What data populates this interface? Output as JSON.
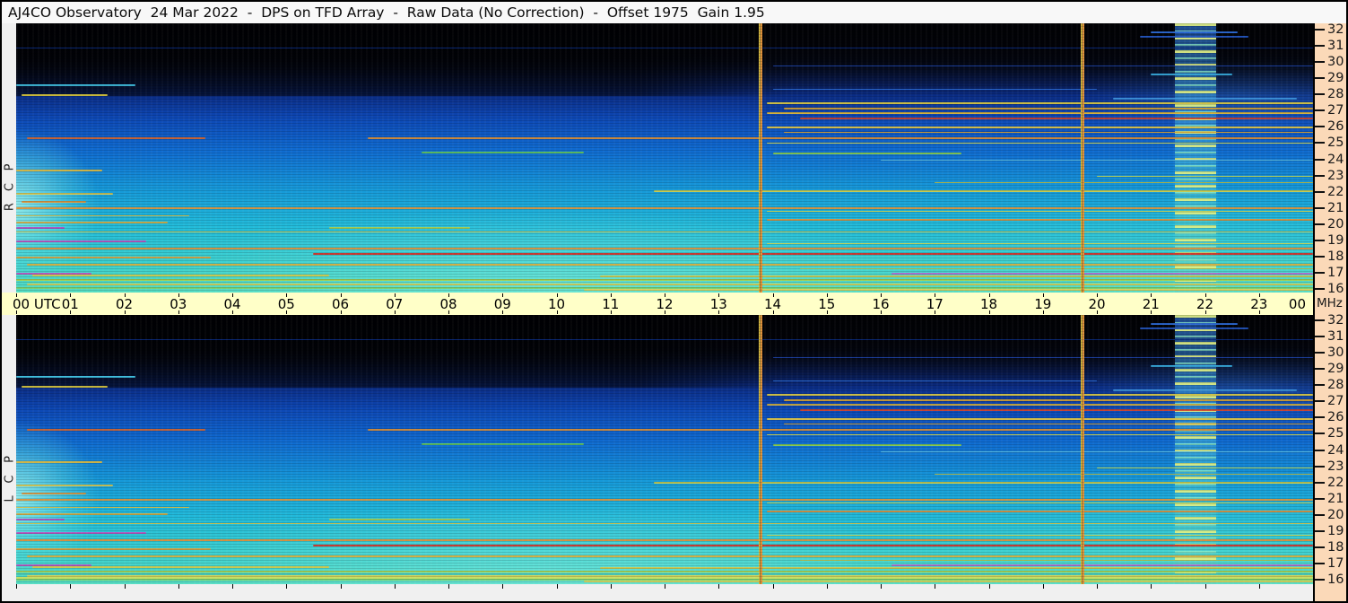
{
  "title": "AJ4CO Observatory  24 Mar 2022  -  DPS on TFD Array  -  Raw Data (No Correction)  -  Offset 1975  Gain 1.95",
  "colors": {
    "titlebar_bg": "#f8f8f8",
    "time_axis_bg": "#ffffc8",
    "freq_gutter_bg": "#fbd9b8",
    "margin_bg": "#f0f0f0",
    "frame_border": "#000000",
    "marker_yellow": "#e5c33c",
    "marker_orange": "#e0923c"
  },
  "chart_data": {
    "type": "heatmap",
    "title": "AJ4CO Observatory  24 Mar 2022  -  DPS on TFD Array  -  Raw Data (No Correction)  -  Offset 1975  Gain 1.95",
    "observatory": "AJ4CO Observatory",
    "date": "24 Mar 2022",
    "instrument": "DPS on TFD Array",
    "data_state": "Raw Data (No Correction)",
    "offset": 1975,
    "gain": 1.95,
    "x_axis": {
      "unit": "UTC",
      "range_hours": [
        0,
        24
      ],
      "tick_labels": [
        "00 UTC",
        "01",
        "02",
        "03",
        "04",
        "05",
        "06",
        "07",
        "08",
        "09",
        "10",
        "11",
        "12",
        "13",
        "14",
        "15",
        "16",
        "17",
        "18",
        "19",
        "20",
        "21",
        "22",
        "23",
        "00"
      ]
    },
    "y_axis": {
      "unit": "MHz",
      "range_mhz": [
        16,
        32
      ],
      "ticks": [
        32,
        31,
        30,
        29,
        28,
        27,
        26,
        25,
        24,
        23,
        22,
        21,
        20,
        19,
        18,
        17,
        16
      ]
    },
    "panels": [
      {
        "id": "rcp",
        "label": "RCP"
      },
      {
        "id": "lcp",
        "label": "LCP"
      }
    ],
    "legend_position": "none",
    "grid": false,
    "colorscale_low_to_high": [
      "#000000",
      "#081536",
      "#0a2a80",
      "#0f6ad0",
      "#169ad9",
      "#3bd0cf",
      "#55dcc2",
      "#a8cf4e",
      "#dcd052",
      "#e0913a",
      "#cc2d24"
    ],
    "vertical_markers_utc": [
      13.78,
      19.73
    ],
    "interference_band_utc": {
      "start": 21.45,
      "end": 22.2
    },
    "background_features": [
      "black above ~28 MHz fading to dark blue on the right half",
      "bright cyan blob at 00-01.5 UTC around 18-23 MHz",
      "broad bright cyan region ~07-13 UTC below 22 MHz",
      "dense yellow-orange RFI band 26.5-27.7 MHz after 14 UTC",
      "striped interference column 21.45-22.2 UTC full bandwidth"
    ],
    "rfi_lines": [
      [
        30.9,
        0,
        24,
        "#0a2f8c",
        1
      ],
      [
        29.8,
        14,
        10,
        "#1b3fa0",
        1
      ],
      [
        28.6,
        0,
        2.2,
        "#44ccee",
        2
      ],
      [
        28.35,
        14,
        6,
        "#2a6ad4",
        1
      ],
      [
        28.0,
        0.1,
        1.6,
        "#d4c23a",
        2
      ],
      [
        27.8,
        20.3,
        3.4,
        "#3e97e0",
        2
      ],
      [
        27.5,
        13.9,
        10.1,
        "#d9c53e",
        2
      ],
      [
        27.2,
        14.2,
        9.8,
        "#cf9a2e",
        2
      ],
      [
        26.9,
        13.9,
        10.1,
        "#e0b93a",
        2
      ],
      [
        26.6,
        14.5,
        9.5,
        "#d2452a",
        2
      ],
      [
        26.0,
        13.9,
        10.1,
        "#e0c340",
        2
      ],
      [
        25.7,
        14.2,
        9.8,
        "#d0992e",
        1
      ],
      [
        25.35,
        0.2,
        3.3,
        "#d0622a",
        2
      ],
      [
        25.35,
        6.5,
        17.5,
        "#d78a30",
        2
      ],
      [
        25.0,
        13.9,
        10.1,
        "#cfd04a",
        1
      ],
      [
        24.45,
        7.5,
        3,
        "#64c85a",
        2
      ],
      [
        24.4,
        14,
        3.5,
        "#8ccf4a",
        2
      ],
      [
        24.0,
        16,
        8,
        "#58b6d8",
        1
      ],
      [
        23.35,
        0,
        1.6,
        "#d9b43c",
        2
      ],
      [
        23.0,
        20,
        4,
        "#bcd24e",
        1
      ],
      [
        22.6,
        17,
        7,
        "#cfd04a",
        1
      ],
      [
        22.1,
        11.8,
        12.2,
        "#d4cf46",
        2
      ],
      [
        21.9,
        0,
        1.8,
        "#dcc84e",
        2
      ],
      [
        21.45,
        0.1,
        1.2,
        "#e0953a",
        2
      ],
      [
        21.05,
        0,
        24,
        "#de8f35",
        2
      ],
      [
        20.8,
        13.9,
        10.1,
        "#c9cf4e",
        1
      ],
      [
        20.55,
        0,
        3.2,
        "#d2b844",
        1
      ],
      [
        20.3,
        13.9,
        10.1,
        "#e0913a",
        2
      ],
      [
        20.15,
        0,
        2.8,
        "#d9ab40",
        2
      ],
      [
        19.8,
        0,
        0.9,
        "#b44fc0",
        2
      ],
      [
        19.8,
        5.8,
        2.6,
        "#aacf4e",
        2
      ],
      [
        19.55,
        0,
        24,
        "#cdbf48",
        1
      ],
      [
        19.0,
        0,
        2.4,
        "#c050c0",
        2
      ],
      [
        18.8,
        13.9,
        10.1,
        "#ccd04e",
        1
      ],
      [
        18.55,
        0,
        24,
        "#e08a32",
        2
      ],
      [
        18.2,
        5.5,
        18.5,
        "#cc2d24",
        2
      ],
      [
        18.0,
        0,
        3.6,
        "#e0a13c",
        2
      ],
      [
        17.55,
        0.2,
        23.8,
        "#d9ab38",
        2
      ],
      [
        17.3,
        14.5,
        9.5,
        "#c8cf52",
        1
      ],
      [
        17.0,
        0,
        1.4,
        "#c050c0",
        2
      ],
      [
        17.0,
        16.2,
        7.8,
        "#b46ad0",
        2
      ],
      [
        16.9,
        0.3,
        5.5,
        "#d2c544",
        2
      ],
      [
        16.85,
        10.8,
        13.2,
        "#d5c94a",
        2
      ],
      [
        16.6,
        0,
        24,
        "#a8cf4e",
        2
      ],
      [
        16.35,
        0.2,
        23.8,
        "#dcd052",
        2
      ],
      [
        16.1,
        0,
        24,
        "#7ecf6a",
        2
      ],
      [
        16.0,
        10.5,
        13.5,
        "#e0d45a",
        2
      ],
      [
        31.9,
        21,
        1.6,
        "#2e6fe0",
        2
      ],
      [
        31.6,
        20.8,
        2,
        "#2458c8",
        2
      ],
      [
        29.3,
        21,
        1.5,
        "#3ab4e8",
        2
      ]
    ],
    "panel_extras": {
      "lcp": [
        [
          16.45,
          0,
          24,
          "#49c8b4",
          2
        ],
        [
          16.2,
          0,
          24,
          "#cfe05a",
          2
        ]
      ]
    }
  }
}
